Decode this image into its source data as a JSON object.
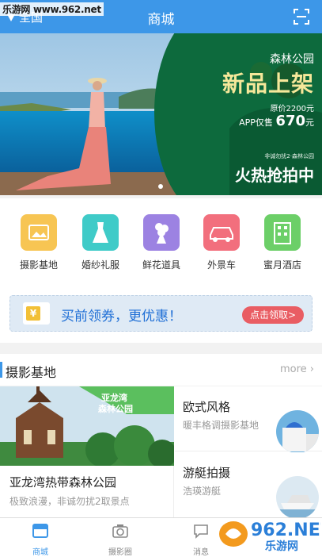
{
  "watermark_top": "乐游网 www.962.net",
  "header": {
    "location": "全国",
    "title": "商城"
  },
  "banner": {
    "park": "森林公园",
    "headline": "新品上架",
    "original_price": "原价2200元",
    "app_price_prefix": "APP仅售",
    "app_price": "670",
    "app_price_unit": "元",
    "small_note": "非诚勿扰2·森林公园",
    "hot": "火热抢拍中"
  },
  "categories": [
    {
      "label": "摄影基地",
      "icon": "photo-base-icon",
      "color": "#f5c24a"
    },
    {
      "label": "婚纱礼服",
      "icon": "wedding-dress-icon",
      "color": "#3ec9c7"
    },
    {
      "label": "鲜花道具",
      "icon": "flower-icon",
      "color": "#9a7fe0"
    },
    {
      "label": "外景车",
      "icon": "car-icon",
      "color": "#f06b7a"
    },
    {
      "label": "蜜月酒店",
      "icon": "hotel-icon",
      "color": "#66cc66"
    }
  ],
  "coupon": {
    "text": "买前领券，更优惠！",
    "button": "点击领取>"
  },
  "section": {
    "title": "摄影基地",
    "more": "more"
  },
  "products": {
    "featured": {
      "badge_line1": "亚龙湾",
      "badge_line2": "森林公园",
      "name": "亚龙湾热带森林公园",
      "desc": "极致浪漫，非诚勿扰2取景点"
    },
    "items": [
      {
        "name": "欧式风格",
        "desc": "暖丰格调摄影基地"
      },
      {
        "name": "游艇拍摄",
        "desc": "浩瑛游艇"
      }
    ]
  },
  "nav": {
    "items": [
      {
        "label": "商城",
        "icon": "store-icon",
        "active": true
      },
      {
        "label": "摄影圈",
        "icon": "camera-icon",
        "active": false
      },
      {
        "label": "消息",
        "icon": "message-icon",
        "active": false
      }
    ]
  },
  "watermark_bottom": {
    "line1": "962.NET",
    "line2": "乐游网"
  }
}
